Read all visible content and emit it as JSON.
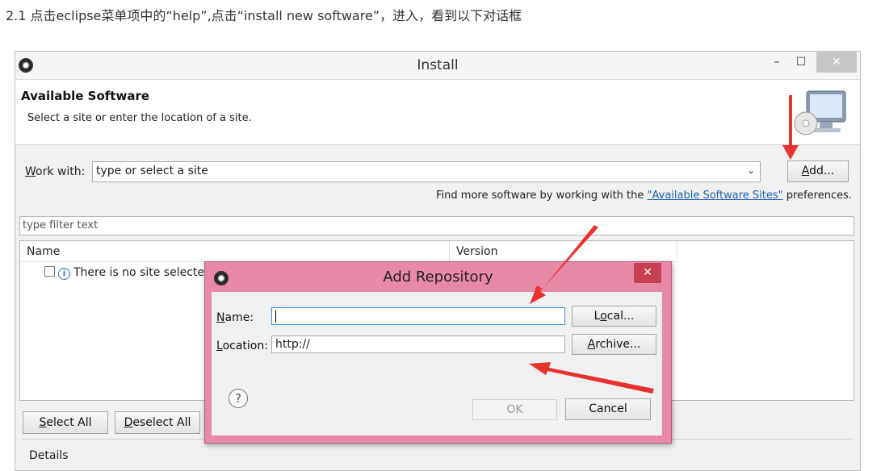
{
  "caption": "2.1 点击eclipse菜单项中的“help”,点击“install new software”，进入，看到以下对话框",
  "window": {
    "title": "Install",
    "minimize": "–",
    "maximize": "☐",
    "close": "✕"
  },
  "banner": {
    "heading": "Available Software",
    "subtitle": "Select a site or enter the location of a site."
  },
  "work_with": {
    "label_ul": "W",
    "label_rest": "ork with:",
    "value": "type or select a site",
    "add_ul": "A",
    "add_rest": "dd..."
  },
  "find_more": {
    "prefix": "Find more software by working with the ",
    "link": "\"Available Software Sites\"",
    "suffix": " preferences."
  },
  "filter": {
    "placeholder": "type filter text"
  },
  "table": {
    "columns": [
      "Name",
      "Version"
    ],
    "rows": [
      {
        "name": "There is no site selected."
      }
    ]
  },
  "buttons": {
    "select_all_ul": "S",
    "select_all_rest": "elect All",
    "deselect_all_ul": "D",
    "deselect_all_rest": "eselect All"
  },
  "details": "Details",
  "dialog": {
    "title": "Add Repository",
    "close": "✕",
    "name_label_ul": "N",
    "name_label_rest": "ame:",
    "name_value": "",
    "location_label_ul": "L",
    "location_label_rest": "ocation:",
    "location_value": "http://",
    "local_pre": "L",
    "local_ul": "o",
    "local_rest": "cal...",
    "archive_ul": "A",
    "archive_rest": "rchive...",
    "help": "?",
    "ok": "OK",
    "cancel": "Cancel"
  },
  "colors": {
    "dialog_frame": "#e889a8",
    "annotation_arrow": "#e8322f",
    "link": "#1a5fb4"
  }
}
